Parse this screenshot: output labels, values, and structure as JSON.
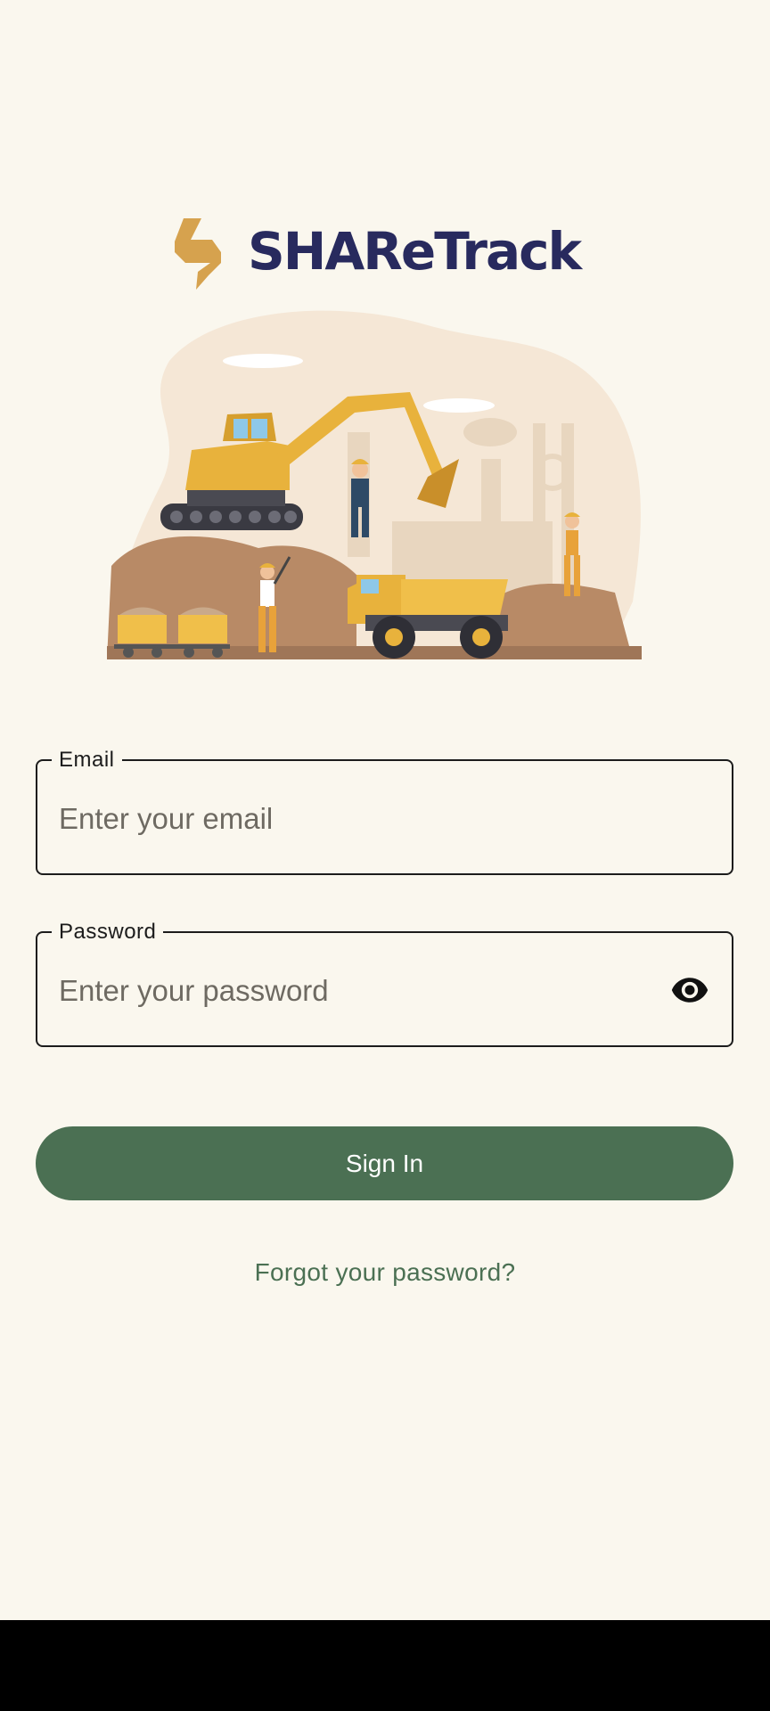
{
  "brand": {
    "name": "SHAReTrack",
    "name_color": "#282a5e",
    "mark_color": "#d6a24e"
  },
  "illustration": {
    "subject": "mining-site-excavator-dump-truck-workers"
  },
  "form": {
    "email": {
      "label": "Email",
      "placeholder": "Enter your email",
      "value": ""
    },
    "password": {
      "label": "Password",
      "placeholder": "Enter your password",
      "value": "",
      "toggle_icon": "eye-icon"
    },
    "sign_in_label": "Sign In",
    "forgot_label": "Forgot your password?"
  },
  "colors": {
    "background": "#faf7ee",
    "accent": "#4b7053",
    "field_border": "#1c1c1c"
  }
}
